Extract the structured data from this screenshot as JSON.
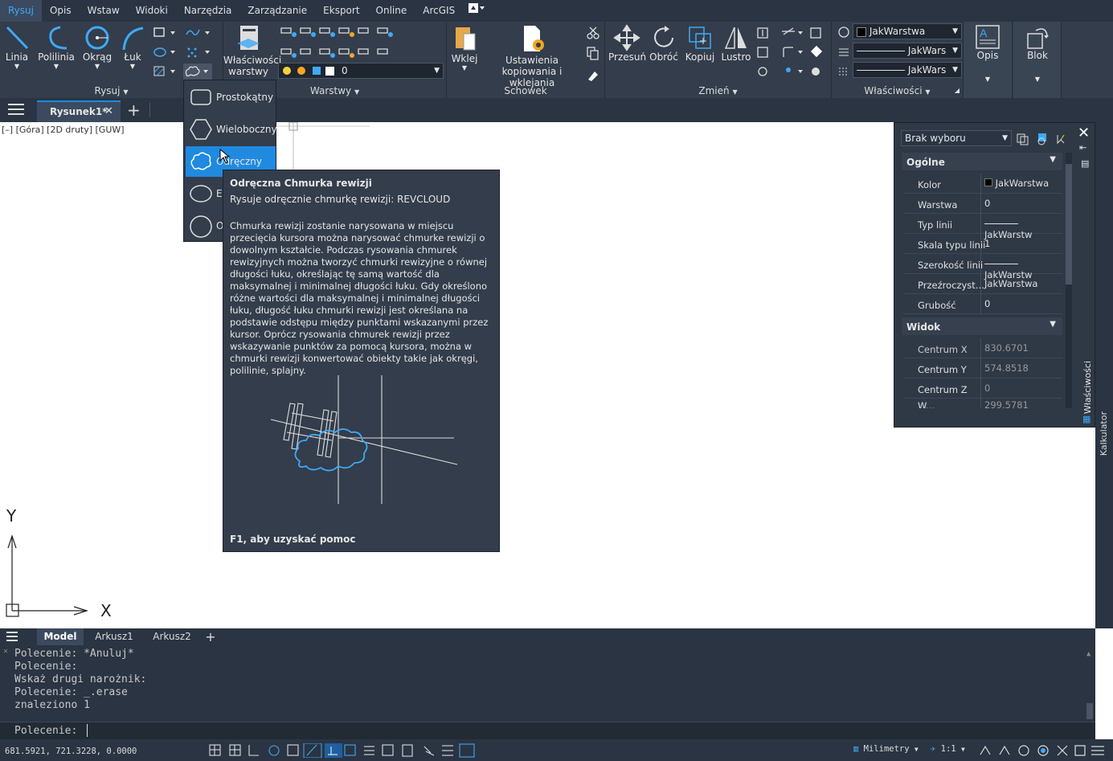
{
  "menu": [
    "Rysuj",
    "Opis",
    "Wstaw",
    "Widoki",
    "Narzędzia",
    "Zarządzanie",
    "Eksport",
    "Online",
    "ArcGIS"
  ],
  "ribbon": {
    "draw": {
      "title": "Rysuj",
      "tools": [
        "Linia",
        "Polilinia",
        "Okrąg",
        "Łuk"
      ]
    },
    "layers": {
      "title": "Warstwy",
      "props_label": "Właściwości warstwy",
      "current_layer": "0"
    },
    "clipboard": {
      "title": "Schowek",
      "paste": "Wklej",
      "copy_settings": "Ustawienia kopiowania i wklejania"
    },
    "modify": {
      "title": "Zmień",
      "tools": [
        "Przesuń",
        "Obróć",
        "Kopiuj",
        "Lustro"
      ]
    },
    "properties": {
      "title": "Właściwości",
      "color": "JakWarstwa",
      "linetype": "JakWars",
      "lineweight": "JakWars"
    },
    "annotation": {
      "label": "Opis"
    },
    "block": {
      "label": "Blok"
    }
  },
  "doc_tab": {
    "name": "Rysunek1*",
    "add": "+"
  },
  "viewport_label": "[–] [Góra] [2D druty] [GUW]",
  "flyout": {
    "items": [
      "Prostokątny",
      "Wieloboczny",
      "Odręczny",
      "Eliptyczny",
      "Okrągły"
    ],
    "visible": [
      "Prostokątny",
      "Wieloboczny",
      "Odręczny",
      "El",
      "O"
    ],
    "selected_index": 2
  },
  "tooltip": {
    "title": "Odręczna Chmurka rewizji",
    "subtitle": "Rysuje odręcznie chmurkę rewizji: REVCLOUD",
    "body": "Chmurka rewizji zostanie narysowana w miejscu przecięcia kursora można narysować chmurke rewizji o dowolnym kształcie. Podczas rysowania chmurek rewizyjnych można tworzyć chmurki rewizyjne o równej długości łuku, określając tę samą wartość dla maksymalnej i minimalnej długości łuku. Gdy określono różne wartości dla maksymalnej i minimalnej długości łuku, długość łuku chmurki rewizji jest określana na podstawie odstępu między punktami wskazanymi przez kursor. Oprócz rysowania chmurek rewizji przez wskazywanie punktów za pomocą kursora, można w chmurki rewizji konwertować obiekty takie jak okręgi, polilinie, splajny.",
    "footer": "F1, aby uzyskać pomoc"
  },
  "properties_panel": {
    "selection": "Brak wyboru",
    "general_title": "Ogólne",
    "general": [
      {
        "label": "Kolor",
        "value": "JakWarstwa"
      },
      {
        "label": "Warstwa",
        "value": "0"
      },
      {
        "label": "Typ linii",
        "value": "JakWarstw"
      },
      {
        "label": "Skala typu linii",
        "value": "1"
      },
      {
        "label": "Szerokość linii",
        "value": "JakWarstw"
      },
      {
        "label": "Przeźroczyst...",
        "value": "JakWarstwa"
      },
      {
        "label": "Grubość",
        "value": "0"
      }
    ],
    "view_title": "Widok",
    "view": [
      {
        "label": "Centrum X",
        "value": "830.6701"
      },
      {
        "label": "Centrum Y",
        "value": "574.8518"
      },
      {
        "label": "Centrum Z",
        "value": "0"
      },
      {
        "label": "W...",
        "value": "299.5781"
      }
    ],
    "side_label": "Właściwości"
  },
  "right_strip_label": "Kalkulator",
  "ucs": {
    "x": "X",
    "y": "Y"
  },
  "layout_tabs": [
    "Model",
    "Arkusz1",
    "Arkusz2"
  ],
  "command_history": [
    "Polecenie: *Anuluj*",
    "Polecenie:",
    "Wskaż drugi narożnik:",
    "Polecenie: _.erase",
    "znaleziono 1"
  ],
  "command_prompt": "Polecenie:",
  "status": {
    "coords": "681.5921, 721.3228, 0.0000",
    "units": "Milimetry",
    "scale": "1:1"
  },
  "colors": {
    "accent": "#1f8ae0",
    "ribbon_bg": "#333d4b",
    "menubar_bg": "#2a3442"
  }
}
